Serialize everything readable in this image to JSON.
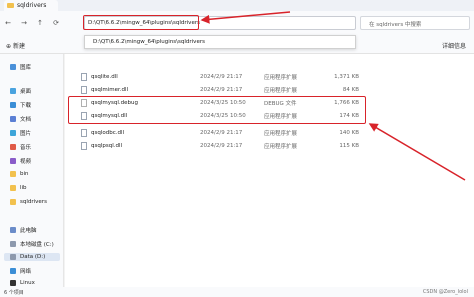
{
  "window": {
    "tab_title": "sqldrivers"
  },
  "addressbar": {
    "path": "D:\\QT\\6.6.2\\mingw_64\\plugins\\sqldrivers",
    "search_placeholder": "在 sqldrivers 中搜索"
  },
  "suggestion": {
    "path": "D:\\QT\\6.6.2\\mingw_64\\plugins\\sqldrivers"
  },
  "toolbar": {
    "new_label": "新建",
    "details_label": "详细信息"
  },
  "sidebar": {
    "items": [
      {
        "label": "图库",
        "icon": "gallery-icon"
      },
      {
        "label": "桌面",
        "icon": "desktop-icon"
      },
      {
        "label": "下载",
        "icon": "download-icon"
      },
      {
        "label": "文档",
        "icon": "documents-icon"
      },
      {
        "label": "图片",
        "icon": "pictures-icon"
      },
      {
        "label": "音乐",
        "icon": "music-icon"
      },
      {
        "label": "视频",
        "icon": "videos-icon"
      },
      {
        "label": "bin",
        "icon": "folder-icon"
      },
      {
        "label": "lib",
        "icon": "folder-icon"
      },
      {
        "label": "sqldrivers",
        "icon": "folder-icon"
      },
      {
        "label": "此电脑",
        "icon": "this-pc-icon"
      },
      {
        "label": "本地磁盘 (C:)",
        "icon": "drive-icon"
      },
      {
        "label": "Data (D:)",
        "icon": "drive-icon"
      },
      {
        "label": "网络",
        "icon": "network-icon"
      },
      {
        "label": "Linux",
        "icon": "linux-icon"
      }
    ]
  },
  "files": [
    {
      "name": "qsqlite.dll",
      "date": "2024/2/9 21:17",
      "type": "应用程序扩展",
      "size": "1,371 KB"
    },
    {
      "name": "qsqlmimer.dll",
      "date": "2024/2/9 21:17",
      "type": "应用程序扩展",
      "size": "84 KB"
    },
    {
      "name": "qsqlmysql.debug",
      "date": "2024/3/25 10:50",
      "type": "DEBUG 文件",
      "size": "1,766 KB"
    },
    {
      "name": "qsqlmysql.dll",
      "date": "2024/3/25 10:50",
      "type": "应用程序扩展",
      "size": "174 KB"
    },
    {
      "name": "qsqlodbc.dll",
      "date": "2024/2/9 21:17",
      "type": "应用程序扩展",
      "size": "140 KB"
    },
    {
      "name": "qsqlpsql.dll",
      "date": "2024/2/9 21:17",
      "type": "应用程序扩展",
      "size": "115 KB"
    }
  ],
  "status": {
    "items_text": "6 个项目"
  },
  "watermark": "CSDN @Zero_lolol",
  "colors": {
    "highlight": "#d8232a",
    "folder": "#f2c14e"
  }
}
